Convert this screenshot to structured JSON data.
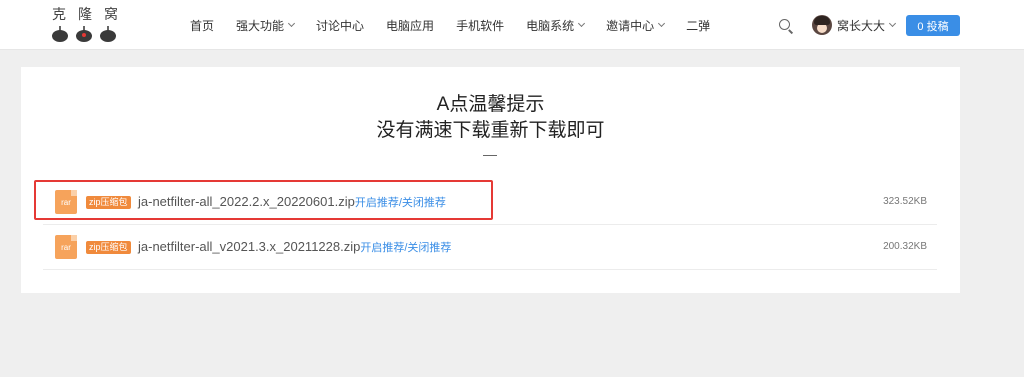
{
  "logo": {
    "text": "克隆窝"
  },
  "nav": {
    "items": [
      {
        "label": "首页",
        "has_dropdown": false
      },
      {
        "label": "强大功能",
        "has_dropdown": true
      },
      {
        "label": "讨论中心",
        "has_dropdown": false
      },
      {
        "label": "电脑应用",
        "has_dropdown": false
      },
      {
        "label": "手机软件",
        "has_dropdown": false
      },
      {
        "label": "电脑系统",
        "has_dropdown": true
      },
      {
        "label": "邀请中心",
        "has_dropdown": true
      },
      {
        "label": "二弹",
        "has_dropdown": false
      }
    ]
  },
  "header": {
    "search_icon": "search-icon",
    "username": "窝长大大",
    "submit_label": "0 投稿",
    "accent_color": "#3a8ee6"
  },
  "notice": {
    "line1": "A点温馨提示",
    "line2": "没有满速下载重新下载即可"
  },
  "files": [
    {
      "icon_label": "rar",
      "tag": "zip压缩包",
      "name": "ja-netfilter-all_2022.2.x_20220601.zip",
      "link": "开启推荐/关闭推荐",
      "size": "323.52KB",
      "highlighted": true
    },
    {
      "icon_label": "rar",
      "tag": "zip压缩包",
      "name": "ja-netfilter-all_v2021.3.x_20211228.zip",
      "link": "开启推荐/关闭推荐",
      "size": "200.32KB",
      "highlighted": false
    }
  ],
  "colors": {
    "highlight_border": "#e53935",
    "tag_bg": "#f08a3c",
    "file_icon_bg": "#f6a35b"
  }
}
